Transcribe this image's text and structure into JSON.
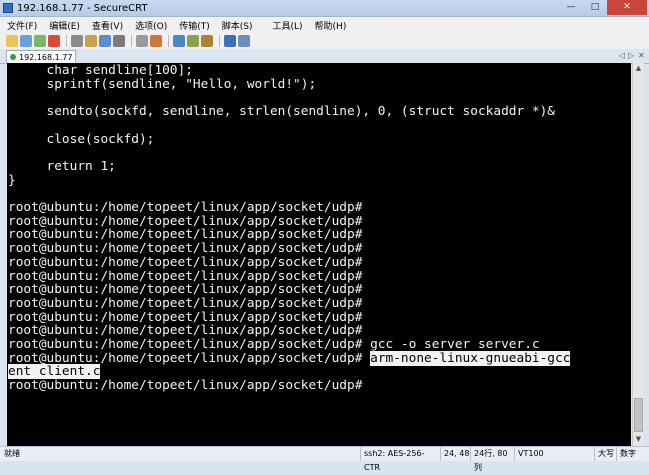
{
  "window": {
    "title": "192.168.1.77 - SecureCRT",
    "min": "—",
    "max": "□",
    "close": "✕"
  },
  "menu": [
    "文件(F)",
    "编辑(E)",
    "查看(V)",
    "选项(O)",
    "传输(T)",
    "脚本(S)",
    "工具(L)",
    "帮助(H)"
  ],
  "toolbar_icons": [
    "connect-icon",
    "quick-connect-icon",
    "reconnect-icon",
    "disconnect-icon",
    "copy-icon",
    "paste-icon",
    "find-icon",
    "print-icon",
    "print-setup-icon",
    "session-options-icon",
    "global-options-icon",
    "keymap-icon",
    "key-icon",
    "help-icon",
    "about-icon"
  ],
  "tab": {
    "label": "192.168.1.77",
    "nav_left": "◁",
    "nav_right": "▷",
    "close": "✕"
  },
  "terminal": {
    "lines": [
      {
        "text": "     char sendline[100];"
      },
      {
        "text": "     sprintf(sendline, \"Hello, world!\");"
      },
      {
        "text": ""
      },
      {
        "text": "     sendto(sockfd, sendline, strlen(sendline), 0, (struct sockaddr *)&"
      },
      {
        "text": ""
      },
      {
        "text": "     close(sockfd);"
      },
      {
        "text": ""
      },
      {
        "text": "     return 1;"
      },
      {
        "text": "}"
      },
      {
        "text": ""
      },
      {
        "text": "root@ubuntu:/home/topeet/linux/app/socket/udp#"
      },
      {
        "text": "root@ubuntu:/home/topeet/linux/app/socket/udp#"
      },
      {
        "text": "root@ubuntu:/home/topeet/linux/app/socket/udp#"
      },
      {
        "text": "root@ubuntu:/home/topeet/linux/app/socket/udp#"
      },
      {
        "text": "root@ubuntu:/home/topeet/linux/app/socket/udp#"
      },
      {
        "text": "root@ubuntu:/home/topeet/linux/app/socket/udp#"
      },
      {
        "text": "root@ubuntu:/home/topeet/linux/app/socket/udp#"
      },
      {
        "text": "root@ubuntu:/home/topeet/linux/app/socket/udp#"
      },
      {
        "text": "root@ubuntu:/home/topeet/linux/app/socket/udp#"
      },
      {
        "text": "root@ubuntu:/home/topeet/linux/app/socket/udp#"
      },
      {
        "text": "root@ubuntu:/home/topeet/linux/app/socket/udp# gcc -o server server.c"
      },
      {
        "text": "root@ubuntu:/home/topeet/linux/app/socket/udp# ",
        "highlight": "arm-none-linux-gnueabi-gcc"
      },
      {
        "text": "",
        "highlight": "ent client.c"
      },
      {
        "text": "root@ubuntu:/home/topeet/linux/app/socket/udp#"
      }
    ]
  },
  "status": {
    "ready": "就绪",
    "cipher": "ssh2: AES-256-CTR",
    "cursor": "24,  48",
    "size": "24行, 80列",
    "emulation": "VT100",
    "caps": "大写",
    "num": "数字"
  }
}
